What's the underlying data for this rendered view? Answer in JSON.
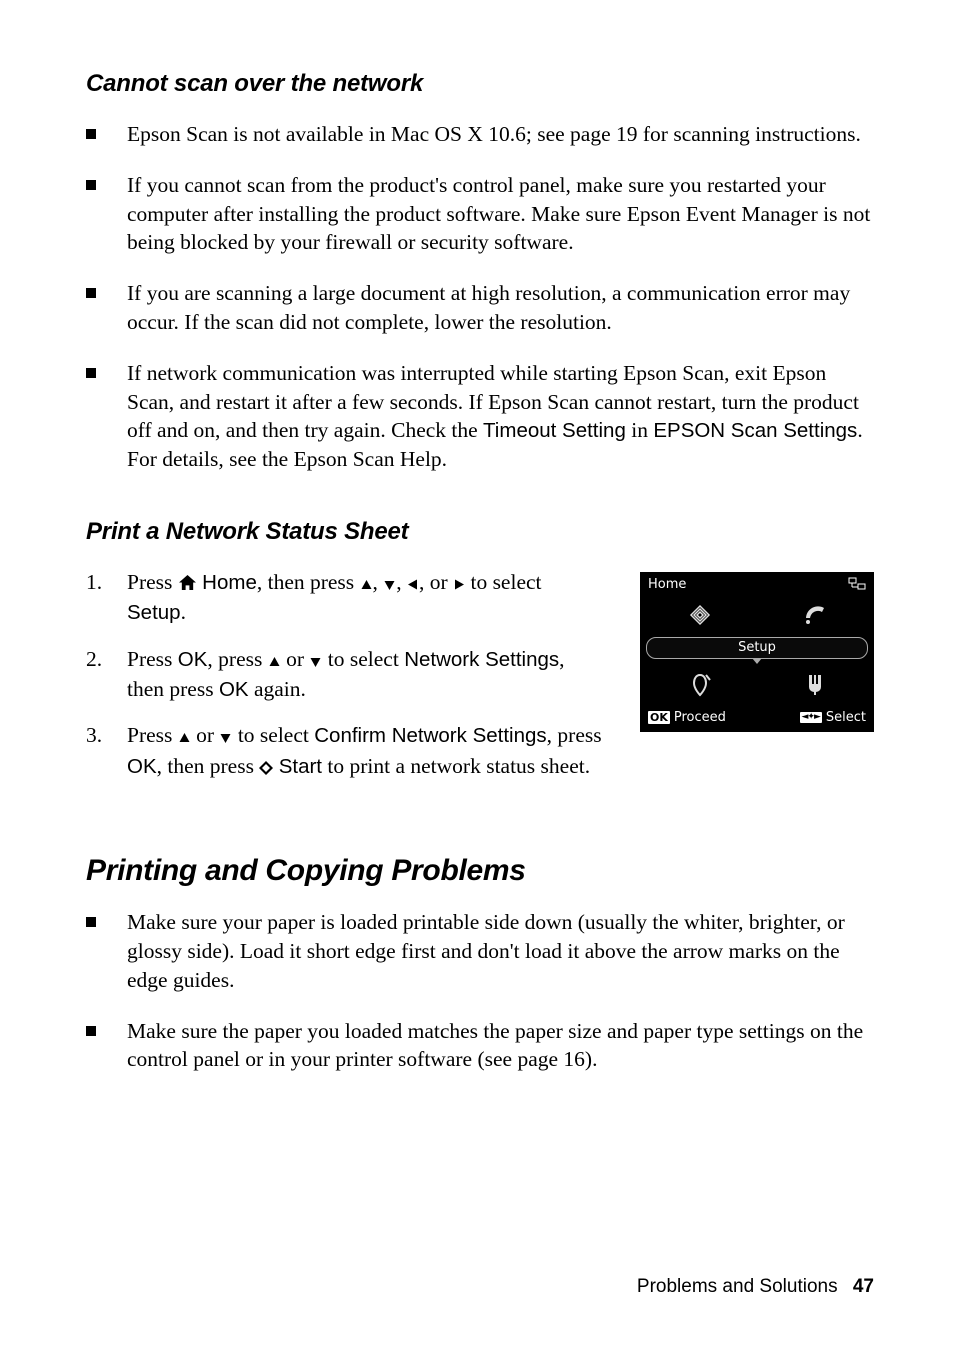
{
  "section1": {
    "heading": "Cannot scan over the network",
    "bullets": [
      {
        "text_before": "Epson Scan is not available in Mac OS X 10.6; see page 19 for scanning instructions."
      },
      {
        "text_before": "If you cannot scan from the product's control panel, make sure you restarted your computer after installing the product software. Make sure Epson Event Manager is not being blocked by your firewall or security software."
      },
      {
        "text_before": "If you are scanning a large document at high resolution, a communication error may occur. If the scan did not complete, lower the resolution."
      },
      {
        "text_before": "If network communication was interrupted while starting Epson Scan, exit Epson Scan, and restart it after a few seconds. If Epson Scan cannot restart, turn the product off and on, and then try again. Check the ",
        "ui1": "Timeout Setting",
        "mid1": " in ",
        "ui2": "EPSON Scan Settings",
        "text_after": ". For details, see the Epson Scan Help."
      }
    ]
  },
  "section2": {
    "heading": "Print a Network Status Sheet",
    "steps": [
      {
        "t1": "Press ",
        "ui1": "Home",
        "t2": ", then press ",
        "t3": " to select ",
        "ui2": "Setup",
        "t4": "."
      },
      {
        "t1": "Press ",
        "ui1": "OK",
        "t2": ", press ",
        "t3": " to select ",
        "ui2": "Network Settings",
        "t4": ", then press ",
        "ui3": "OK",
        "t5": " again."
      },
      {
        "t1": "Press ",
        "t2": " to select ",
        "ui1": "Confirm Network Settings",
        "t3": ", press ",
        "ui2": "OK",
        "t4": ", then press ",
        "ui3": "Start",
        "t5": " to print a network status sheet."
      }
    ]
  },
  "lcd": {
    "title": "Home",
    "pill": "Setup",
    "ok": "OK",
    "proceed": "Proceed",
    "select": "Select"
  },
  "section3": {
    "heading": "Printing and Copying Problems",
    "bullets": [
      "Make sure your paper is loaded printable side down (usually the whiter, brighter, or glossy side). Load it short edge first and don't load it above the arrow marks on the edge guides.",
      "Make sure the paper you loaded matches the paper size and paper type settings on the control panel or in your printer software (see page 16)."
    ]
  },
  "footer": {
    "section": "Problems and Solutions",
    "page": "47"
  }
}
